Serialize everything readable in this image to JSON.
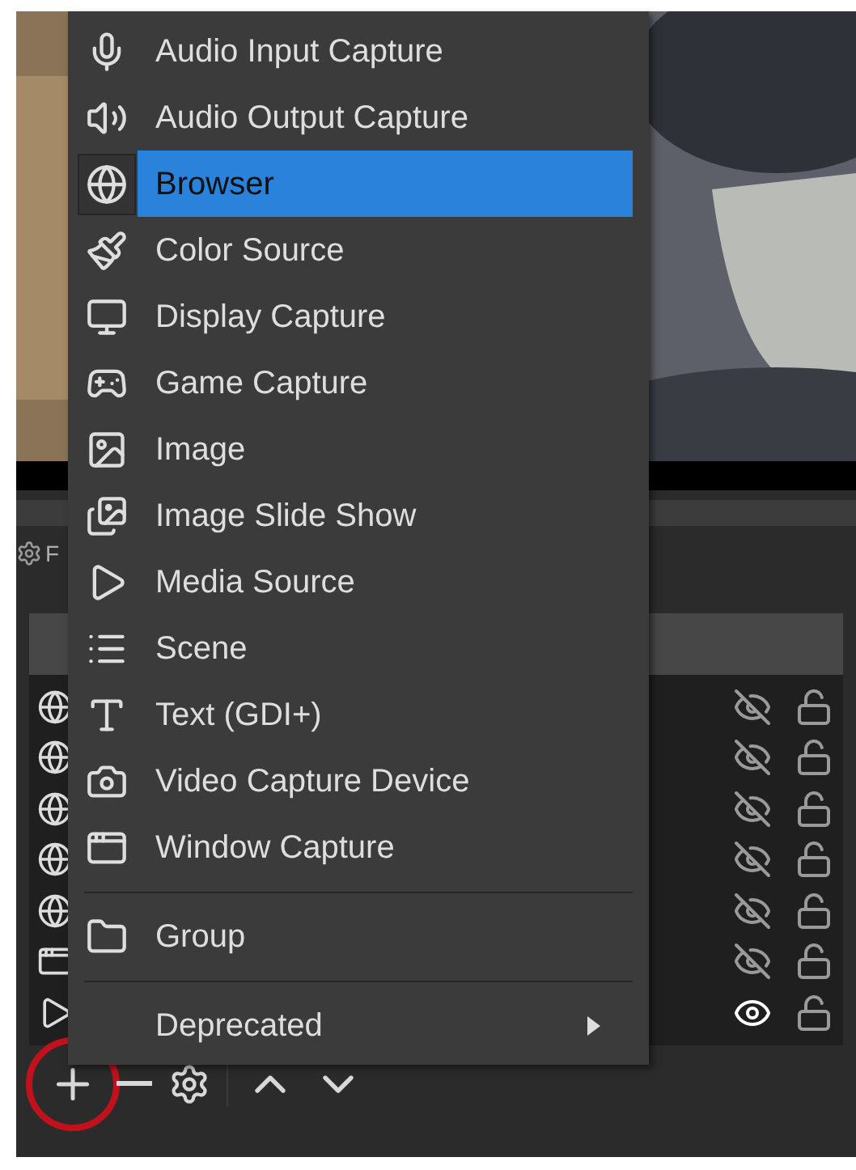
{
  "sources_dock": {
    "title_fragment": "F",
    "rows": [
      {
        "visible": false,
        "locked": false
      },
      {
        "visible": false,
        "locked": false
      },
      {
        "visible": false,
        "locked": false
      },
      {
        "visible": false,
        "locked": false
      },
      {
        "visible": false,
        "locked": false
      },
      {
        "visible": false,
        "locked": false
      },
      {
        "visible": true,
        "locked": false
      }
    ],
    "toolbar": {
      "add_highlighted": true
    }
  },
  "add_source_menu": {
    "items": [
      {
        "kind": "item",
        "label": "Audio Input Capture",
        "selected": false
      },
      {
        "kind": "item",
        "label": "Audio Output Capture",
        "selected": false
      },
      {
        "kind": "item",
        "label": "Browser",
        "selected": true
      },
      {
        "kind": "item",
        "label": "Color Source",
        "selected": false
      },
      {
        "kind": "item",
        "label": "Display Capture",
        "selected": false
      },
      {
        "kind": "item",
        "label": "Game Capture",
        "selected": false
      },
      {
        "kind": "item",
        "label": "Image",
        "selected": false
      },
      {
        "kind": "item",
        "label": "Image Slide Show",
        "selected": false
      },
      {
        "kind": "item",
        "label": "Media Source",
        "selected": false
      },
      {
        "kind": "item",
        "label": "Scene",
        "selected": false
      },
      {
        "kind": "item",
        "label": "Text (GDI+)",
        "selected": false
      },
      {
        "kind": "item",
        "label": "Video Capture Device",
        "selected": false
      },
      {
        "kind": "item",
        "label": "Window Capture",
        "selected": false
      },
      {
        "kind": "separator"
      },
      {
        "kind": "item",
        "label": "Group",
        "selected": false
      },
      {
        "kind": "separator"
      },
      {
        "kind": "submenu",
        "label": "Deprecated",
        "selected": false
      }
    ]
  }
}
